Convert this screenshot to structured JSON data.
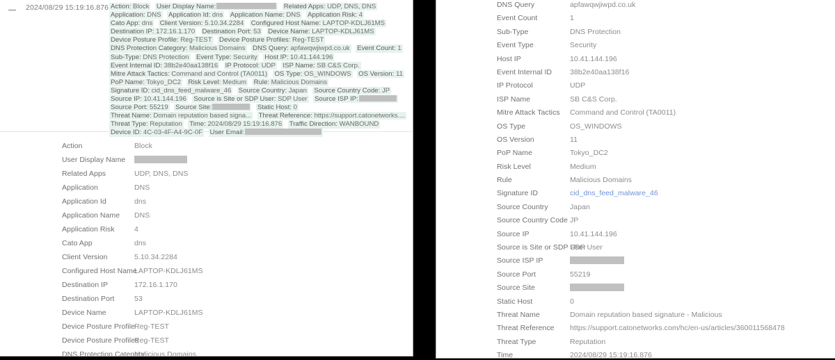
{
  "event": {
    "collapse_icon": "minus-icon",
    "timestamp": "2024/08/29 15:19:16.876"
  },
  "tags": [
    {
      "key": "Action:",
      "value": "Block"
    },
    {
      "key": "User Display Name:",
      "value": "",
      "redacted": true,
      "redact_width": 86
    },
    {
      "key": "Related Apps:",
      "value": "UDP, DNS, DNS"
    },
    {
      "key": "Application:",
      "value": "DNS"
    },
    {
      "key": "Application Id:",
      "value": "dns"
    },
    {
      "key": "Application Name:",
      "value": "DNS"
    },
    {
      "key": "Application Risk:",
      "value": "4"
    },
    {
      "key": "Cato App:",
      "value": "dns"
    },
    {
      "key": "Client Version:",
      "value": "5.10.34.2284"
    },
    {
      "key": "Configured Host Name:",
      "value": "LAPTOP-KDLJ61MS"
    },
    {
      "key": "Destination IP:",
      "value": "172.16.1.170"
    },
    {
      "key": "Destination Port:",
      "value": "53"
    },
    {
      "key": "Device Name:",
      "value": "LAPTOP-KDLJ61MS"
    },
    {
      "key": "Device Posture Profile:",
      "value": "Reg-TEST"
    },
    {
      "key": "Device Posture Profiles:",
      "value": "Reg-TEST"
    },
    {
      "key": "DNS Protection Category:",
      "value": "Malicious Domains"
    },
    {
      "key": "DNS Query:",
      "value": "apfawqwjiwpd.co.uk"
    },
    {
      "key": "Event Count:",
      "value": "1"
    },
    {
      "key": "Sub-Type:",
      "value": "DNS Protection"
    },
    {
      "key": "Event Type:",
      "value": "Security"
    },
    {
      "key": "Host IP:",
      "value": "10.41.144.196"
    },
    {
      "key": "Event Internal ID:",
      "value": "38b2e40aa138f16"
    },
    {
      "key": "IP Protocol:",
      "value": "UDP"
    },
    {
      "key": "ISP Name:",
      "value": "SB C&S Corp."
    },
    {
      "key": "Mitre Attack Tactics:",
      "value": "Command and Control (TA0011)"
    },
    {
      "key": "OS Type:",
      "value": "OS_WINDOWS"
    },
    {
      "key": "OS Version:",
      "value": "11"
    },
    {
      "key": "PoP Name:",
      "value": "Tokyo_DC2"
    },
    {
      "key": "Risk Level:",
      "value": "Medium"
    },
    {
      "key": "Rule:",
      "value": "Malicious Domains"
    },
    {
      "key": "Signature ID:",
      "value": "cid_dns_feed_malware_46"
    },
    {
      "key": "Source Country:",
      "value": "Japan"
    },
    {
      "key": "Source Country Code:",
      "value": "JP"
    },
    {
      "key": "Source IP:",
      "value": "10.41.144.196"
    },
    {
      "key": "Source is Site or SDP User:",
      "value": "SDP User"
    },
    {
      "key": "Source ISP IP:",
      "value": "",
      "redacted": true,
      "redact_width": 54
    },
    {
      "key": "Source Port:",
      "value": "55219"
    },
    {
      "key": "Source Site:",
      "value": "",
      "redacted": true,
      "redact_width": 54
    },
    {
      "key": "Static Host:",
      "value": "0"
    },
    {
      "key": "Threat Name:",
      "value": "Domain reputation based signa..."
    },
    {
      "key": "Threat Reference:",
      "value": "https://support.catonetworks...."
    },
    {
      "key": "Threat Type:",
      "value": "Reputation"
    },
    {
      "key": "Time:",
      "value": "2024/08/29 15:19:16.876"
    },
    {
      "key": "Traffic Direction:",
      "value": "WANBOUND"
    },
    {
      "key": "Device ID:",
      "value": "4C-03-4F-A4-9C-0F"
    },
    {
      "key": "User Email:",
      "value": "",
      "redacted": true,
      "redact_width": 110
    }
  ],
  "left_details": [
    {
      "label": "Action",
      "value": "Block"
    },
    {
      "label": "User Display Name",
      "value": "",
      "redacted": true,
      "redact_width": 76
    },
    {
      "label": "Related Apps",
      "value": "UDP, DNS, DNS"
    },
    {
      "label": "Application",
      "value": "DNS"
    },
    {
      "label": "Application Id",
      "value": "dns"
    },
    {
      "label": "Application Name",
      "value": "DNS"
    },
    {
      "label": "Application Risk",
      "value": "4"
    },
    {
      "label": "Cato App",
      "value": "dns"
    },
    {
      "label": "Client Version",
      "value": "5.10.34.2284"
    },
    {
      "label": "Configured Host Name",
      "value": "LAPTOP-KDLJ61MS"
    },
    {
      "label": "Destination IP",
      "value": "172.16.1.170"
    },
    {
      "label": "Destination Port",
      "value": "53"
    },
    {
      "label": "Device Name",
      "value": "LAPTOP-KDLJ61MS"
    },
    {
      "label": "Device Posture Profile",
      "value": "Reg-TEST"
    },
    {
      "label": "Device Posture Profiles",
      "value": "Reg-TEST"
    },
    {
      "label": "DNS Protection Category",
      "value": "Malicious Domains"
    }
  ],
  "right_details": [
    {
      "label": "DNS Query",
      "value": "apfawqwjiwpd.co.uk"
    },
    {
      "label": "Event Count",
      "value": "1"
    },
    {
      "label": "Sub-Type",
      "value": "DNS Protection"
    },
    {
      "label": "Event Type",
      "value": "Security"
    },
    {
      "label": "Host IP",
      "value": "10.41.144.196"
    },
    {
      "label": "Event Internal ID",
      "value": "38b2e40aa138f16"
    },
    {
      "label": "IP Protocol",
      "value": "UDP"
    },
    {
      "label": "ISP Name",
      "value": "SB C&S Corp."
    },
    {
      "label": "Mitre Attack Tactics",
      "value": "Command and Control (TA0011)"
    },
    {
      "label": "OS Type",
      "value": "OS_WINDOWS"
    },
    {
      "label": "OS Version",
      "value": "11"
    },
    {
      "label": "PoP Name",
      "value": "Tokyo_DC2"
    },
    {
      "label": "Risk Level",
      "value": "Medium"
    },
    {
      "label": "Rule",
      "value": "Malicious Domains"
    },
    {
      "label": "Signature ID",
      "value": "cid_dns_feed_malware_46",
      "link": true
    },
    {
      "label": "Source Country",
      "value": "Japan"
    },
    {
      "label": "Source Country Code",
      "value": "JP"
    },
    {
      "label": "Source IP",
      "value": "10.41.144.196"
    },
    {
      "label": "Source is Site or SDP User",
      "value": "SDP User"
    },
    {
      "label": "Source ISP IP",
      "value": "",
      "redacted": true,
      "redact_width": 78
    },
    {
      "label": "Source Port",
      "value": "55219"
    },
    {
      "label": "Source Site",
      "value": "",
      "redacted": true,
      "redact_width": 78
    },
    {
      "label": "Static Host",
      "value": "0"
    },
    {
      "label": "Threat Name",
      "value": "Domain reputation based signature - Malicious"
    },
    {
      "label": "Threat Reference",
      "value": "https://support.catonetworks.com/hc/en-us/articles/360011568478"
    },
    {
      "label": "Threat Type",
      "value": "Reputation"
    },
    {
      "label": "Time",
      "value": "2024/08/29 15:19:16.876"
    }
  ],
  "colors": {
    "tag_background": "#e7f2ed",
    "redaction": "#c0c0c0",
    "label_text": "#707070",
    "value_text": "#8c8c8c",
    "link_text": "#6e93d6",
    "gutter": "#000000"
  }
}
